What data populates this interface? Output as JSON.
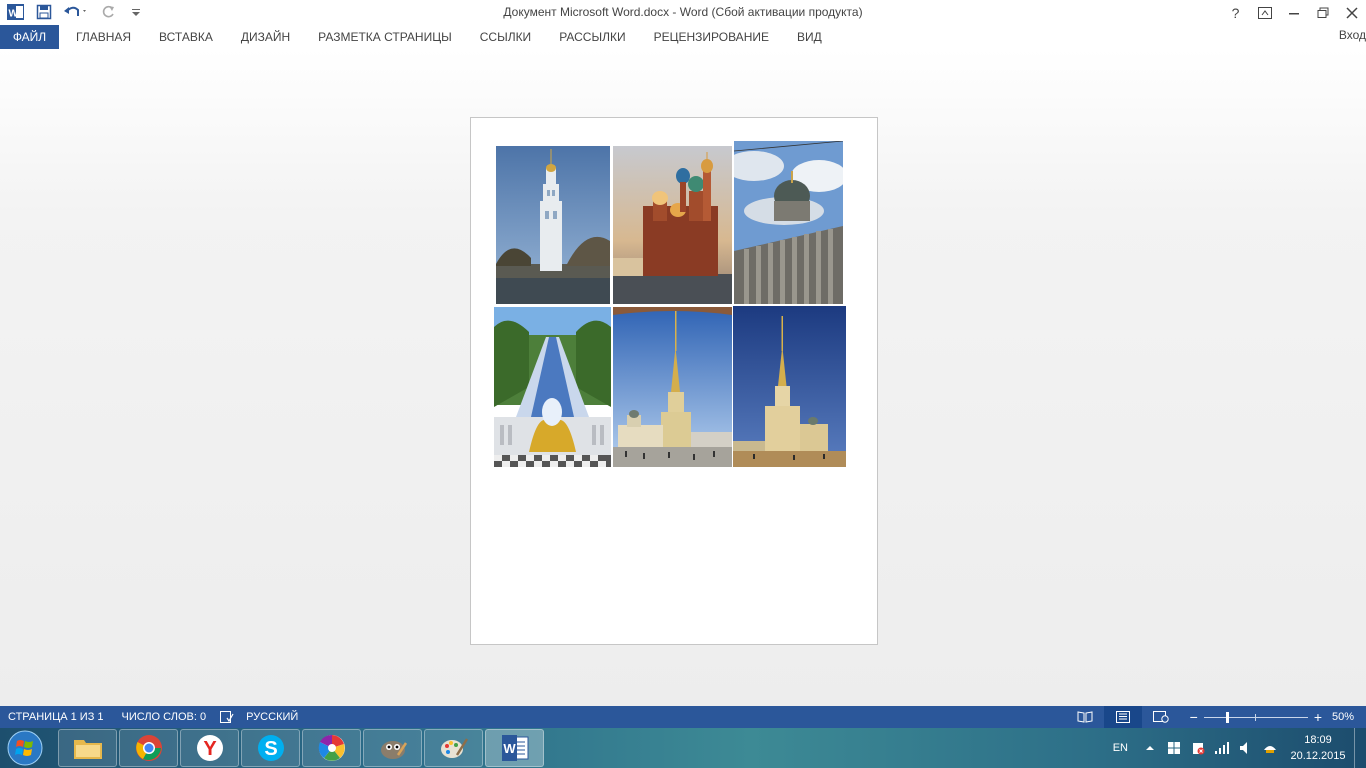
{
  "window": {
    "title": "Документ Microsoft Word.docx - Word (Сбой активации продукта)",
    "help": "?",
    "sign_in": "Вход"
  },
  "ribbon": {
    "file_tab": "ФАЙЛ",
    "tabs": [
      "ГЛАВНАЯ",
      "ВСТАВКА",
      "ДИЗАЙН",
      "РАЗМЕТКА СТРАНИЦЫ",
      "ССЫЛКИ",
      "РАССЫЛКИ",
      "РЕЦЕНЗИРОВАНИЕ",
      "ВИД"
    ]
  },
  "document": {
    "images": [
      {
        "subject": "bell tower on canal",
        "colors": [
          "#5b7fae",
          "#8fb0d6",
          "#e8ecef",
          "#5a5a52"
        ]
      },
      {
        "subject": "Church of the Savior on Spilled Blood",
        "colors": [
          "#c9b8a4",
          "#f0c47a",
          "#8a3b24",
          "#4a4f55"
        ]
      },
      {
        "subject": "Kazan Cathedral colonnade",
        "colors": [
          "#6f9bd1",
          "#dfe6ee",
          "#4d5a55",
          "#6e6c66"
        ]
      },
      {
        "subject": "Peterhof Grand Cascade fountain",
        "colors": [
          "#7ab0e4",
          "#4d7f3a",
          "#c9d7ec",
          "#d7a92a"
        ]
      },
      {
        "subject": "Peter and Paul Cathedral spire",
        "colors": [
          "#3f74c4",
          "#9fc0ea",
          "#e0cf9a",
          "#d7c18a"
        ]
      },
      {
        "subject": "Peter and Paul Cathedral at dusk",
        "colors": [
          "#1c3a80",
          "#3b61a8",
          "#e6d5a6",
          "#b08c58"
        ]
      }
    ]
  },
  "statusbar": {
    "page": "СТРАНИЦА 1 ИЗ 1",
    "words": "ЧИСЛО СЛОВ: 0",
    "language": "РУССКИЙ",
    "zoom": "50%",
    "zoom_percent": 50
  },
  "taskbar": {
    "apps": [
      "file-explorer",
      "chrome",
      "yandex-browser",
      "skype",
      "picasa",
      "gimp",
      "paint",
      "word"
    ],
    "tray": {
      "language": "EN",
      "time": "18:09",
      "date": "20.12.2015"
    }
  },
  "colors": {
    "accent": "#2b579a",
    "statusbar": "#2b579a"
  }
}
